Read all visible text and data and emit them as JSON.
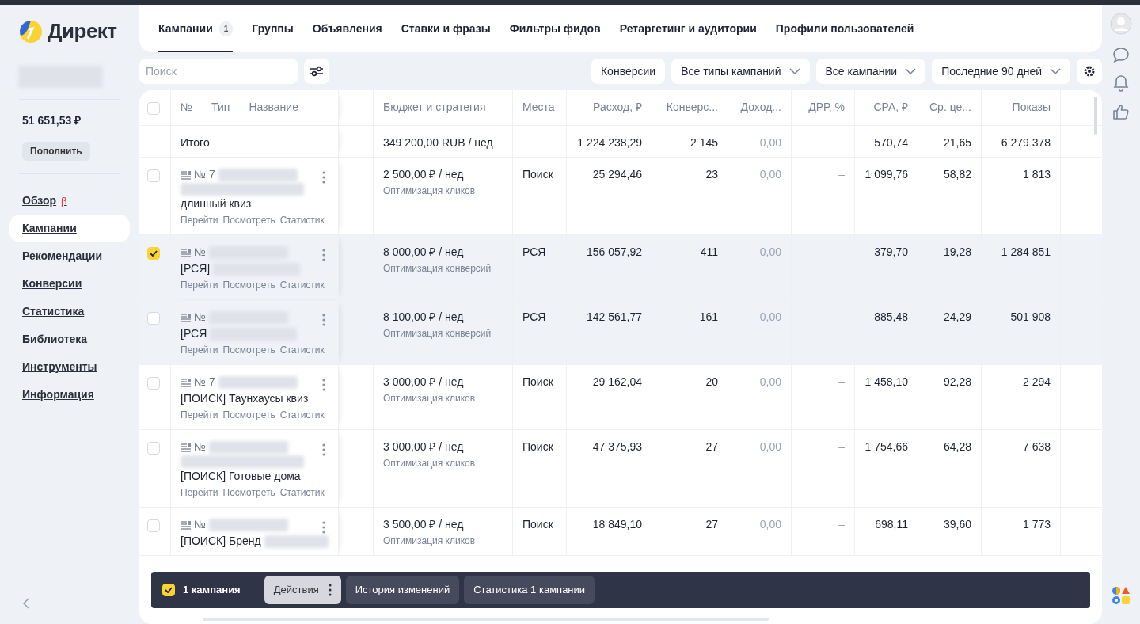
{
  "logo": {
    "text": "Директ"
  },
  "sidebar": {
    "balance": "51 651,53 ₽",
    "topup_button": "Пополнить",
    "items": [
      {
        "label": "Обзор",
        "badge": "β",
        "selected": false
      },
      {
        "label": "Кампании",
        "selected": true
      },
      {
        "label": "Рекомендации",
        "selected": false
      },
      {
        "label": "Конверсии",
        "selected": false
      },
      {
        "label": "Статистика",
        "selected": false
      },
      {
        "label": "Библиотека",
        "selected": false
      },
      {
        "label": "Инструменты",
        "selected": false
      },
      {
        "label": "Информация",
        "selected": false
      }
    ]
  },
  "tabs": [
    {
      "label": "Кампании",
      "count": "1",
      "selected": true
    },
    {
      "label": "Группы",
      "selected": false
    },
    {
      "label": "Объявления",
      "selected": false
    },
    {
      "label": "Ставки и фразы",
      "selected": false
    },
    {
      "label": "Фильтры фидов",
      "selected": false
    },
    {
      "label": "Ретаргетинг и аудитории",
      "selected": false
    },
    {
      "label": "Профили пользователей",
      "selected": false
    }
  ],
  "search": {
    "placeholder": "Поиск"
  },
  "filters": [
    {
      "label": "Конверсии",
      "dropdown": false
    },
    {
      "label": "Все типы кампаний",
      "dropdown": true
    },
    {
      "label": "Все кампании",
      "dropdown": true
    },
    {
      "label": "Последние 90 дней",
      "dropdown": true
    }
  ],
  "table": {
    "all_selected": false,
    "name_header": [
      "№",
      "Тип",
      "Название"
    ],
    "columns": [
      {
        "label": "Бюджет и стратегия",
        "numeric": false,
        "muted": false
      },
      {
        "label": "Места",
        "numeric": false,
        "muted": false
      },
      {
        "label": "Расход, ₽",
        "numeric": true,
        "muted": false
      },
      {
        "label": "Конверс...",
        "numeric": true,
        "muted": false
      },
      {
        "label": "Доход...",
        "numeric": true,
        "muted": true
      },
      {
        "label": "ДРР, %",
        "numeric": true,
        "muted": true
      },
      {
        "label": "CPA, ₽",
        "numeric": true,
        "muted": false
      },
      {
        "label": "Ср. це...",
        "numeric": true,
        "muted": false
      },
      {
        "label": "Показы",
        "numeric": true,
        "muted": false
      }
    ],
    "total": {
      "label": "Итого",
      "cells": [
        "349 200,00 RUB / нед",
        null,
        "1 224 238,29",
        "2 145",
        "0,00",
        null,
        "570,74",
        "21,65",
        "6 279 378"
      ]
    },
    "rows": [
      {
        "selected": false,
        "hovered": false,
        "number": "№ 7",
        "blur_line": true,
        "name_blurred": false,
        "name": "длинный квиз",
        "links": [
          "Перейти",
          "Посмотреть",
          "Статистик"
        ],
        "strategy": "Оптимизация кликов",
        "cells": [
          "2 500,00 ₽ / нед",
          "Поиск",
          "25 294,46",
          "23",
          "0,00",
          "–",
          "1 099,76",
          "58,82",
          "1 813"
        ]
      },
      {
        "selected": true,
        "hovered": false,
        "number": "№",
        "blur_line": false,
        "name_blurred": true,
        "name": "[РСЯ]",
        "links": [
          "Перейти",
          "Посмотреть",
          "Статистик"
        ],
        "strategy": "Оптимизация конверсий",
        "cells": [
          "8 000,00 ₽ / нед",
          "РСЯ",
          "156 057,92",
          "411",
          "0,00",
          "–",
          "379,70",
          "19,28",
          "1 284 851"
        ]
      },
      {
        "selected": false,
        "hovered": true,
        "number": "№",
        "blur_line": false,
        "name_blurred": true,
        "name": "[РСЯ",
        "links": [
          "Перейти",
          "Посмотреть",
          "Статистик"
        ],
        "strategy": "Оптимизация конверсий",
        "cells": [
          "8 100,00 ₽ / нед",
          "РСЯ",
          "142 561,77",
          "161",
          "0,00",
          "–",
          "885,48",
          "24,29",
          "501 908"
        ]
      },
      {
        "selected": false,
        "hovered": false,
        "number": "№ 7",
        "blur_line": false,
        "name_blurred": false,
        "name": "[ПОИСК] Таунхаусы квиз",
        "links": [
          "Перейти",
          "Посмотреть",
          "Статистик"
        ],
        "strategy": "Оптимизация кликов",
        "cells": [
          "3 000,00 ₽ / нед",
          "Поиск",
          "29 162,04",
          "20",
          "0,00",
          "–",
          "1 458,10",
          "92,28",
          "2 294"
        ]
      },
      {
        "selected": false,
        "hovered": false,
        "number": "№",
        "blur_line": true,
        "name_blurred": false,
        "name": "[ПОИСК] Готовые дома",
        "links": [
          "Перейти",
          "Посмотреть",
          "Статистик"
        ],
        "strategy": "Оптимизация кликов",
        "cells": [
          "3 000,00 ₽ / нед",
          "Поиск",
          "47 375,93",
          "27",
          "0,00",
          "–",
          "1 754,66",
          "64,28",
          "7 638"
        ]
      },
      {
        "selected": false,
        "hovered": false,
        "number": "№",
        "blur_line": false,
        "name_blurred": true,
        "name": "[ПОИСК] Бренд",
        "strategy": "Оптимизация кликов",
        "cells": [
          "3 500,00 ₽ / нед",
          "Поиск",
          "18 849,10",
          "27",
          "0,00",
          "–",
          "698,11",
          "39,60",
          "1 773"
        ]
      }
    ]
  },
  "action_bar": {
    "checked": true,
    "count": "1 кампания",
    "buttons": [
      {
        "label": "Действия",
        "kind": "menu"
      },
      {
        "label": "История изменений",
        "kind": "plain"
      },
      {
        "label": "Статистика 1 кампании",
        "kind": "plain"
      }
    ]
  }
}
